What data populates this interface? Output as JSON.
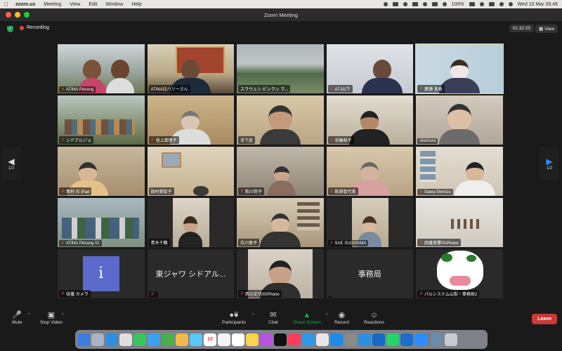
{
  "menubar": {
    "app": "zoom.us",
    "items": [
      "Meeting",
      "View",
      "Edit",
      "Window",
      "Help"
    ],
    "battery": "100%",
    "datetime": "Wed 10 Mar  09.46"
  },
  "window": {
    "title": "Zoom Meeting"
  },
  "status": {
    "recording": "Recording",
    "elapsed": "01:32:25",
    "view": "View"
  },
  "pager": {
    "left": "1/2",
    "right": "1/2"
  },
  "tiles": [
    {
      "name": "ATINA Pinrang",
      "muted": true
    },
    {
      "name": "ATINA比ハリーさん",
      "muted": false
    },
    {
      "name": "スラウェシ ピンラン マ...",
      "muted": false
    },
    {
      "name": "ATJ山下",
      "muted": true
    },
    {
      "name": "廣瀬 美香",
      "muted": true
    },
    {
      "name": "シドアルジョ",
      "muted": true
    },
    {
      "name": "池上真理子",
      "muted": true
    },
    {
      "name": "寺下武",
      "muted": false
    },
    {
      "name": "花輪昭子",
      "muted": true
    },
    {
      "name": "okamura",
      "muted": false
    },
    {
      "name": "島村 の iPad",
      "muted": true
    },
    {
      "name": "田村美智子",
      "muted": false
    },
    {
      "name": "粕川邦子",
      "muted": true
    },
    {
      "name": "萩原智代美",
      "muted": true
    },
    {
      "name": "Sawa Shimizu",
      "muted": true
    },
    {
      "name": "ATINA Pinrang 01",
      "muted": true
    },
    {
      "name": "青木千鶴",
      "muted": false
    },
    {
      "name": "白川恵子",
      "muted": false
    },
    {
      "name": "SAE SUGIYAMA",
      "muted": true
    },
    {
      "name": "田邊美響のiPhone",
      "muted": true
    },
    {
      "name": "収播 カメラ",
      "muted": true
    },
    {
      "name": "",
      "muted": true
    },
    {
      "name": "西元史也のiPhone",
      "muted": true
    },
    {
      "name": "",
      "muted": false
    },
    {
      "name": "パルシステム山梨・事務局2",
      "muted": true
    }
  ],
  "tile_texts": {
    "t21": "東ジャワ シドアル...",
    "t23": "事務局",
    "t20_letter": "i"
  },
  "toolbar": {
    "mute": "Mute",
    "stop_video": "Stop Video",
    "participants": "Participants",
    "participant_count": "27",
    "chat": "Chat",
    "share": "Share Screen",
    "record": "Record",
    "reactions": "Reactions",
    "leave": "Leave"
  },
  "dock": {
    "calendar_day": "10"
  },
  "colors": {
    "accent": "#2d8cff",
    "share_green": "#23a55a",
    "leave_red": "#c93a35",
    "rec_red": "#e8423a",
    "active_speaker": "#e6e35a"
  }
}
